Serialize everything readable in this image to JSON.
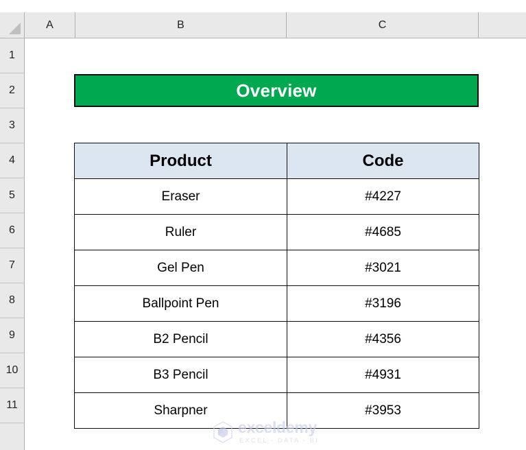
{
  "app": {
    "type": "spreadsheet",
    "select_all_label": "Select All"
  },
  "columns": [
    {
      "label": "A"
    },
    {
      "label": "B"
    },
    {
      "label": "C"
    },
    {
      "label": ""
    }
  ],
  "rows": [
    {
      "label": "1"
    },
    {
      "label": "2"
    },
    {
      "label": "3"
    },
    {
      "label": "4"
    },
    {
      "label": "5"
    },
    {
      "label": "6"
    },
    {
      "label": "7"
    },
    {
      "label": "8"
    },
    {
      "label": "9"
    },
    {
      "label": "10"
    },
    {
      "label": "11"
    },
    {
      "label": ""
    }
  ],
  "title_banner": {
    "text": "Overview",
    "fill_color": "#00A94F",
    "text_color": "#FFFFFF",
    "border_color": "#0D0D0D"
  },
  "table": {
    "header_fill": "#DCE6F1",
    "border_color": "#0D0D0D",
    "headers": [
      "Product",
      "Code"
    ],
    "rows": [
      {
        "product": "Eraser",
        "code": "#4227"
      },
      {
        "product": "Ruler",
        "code": "#4685"
      },
      {
        "product": "Gel Pen",
        "code": "#3021"
      },
      {
        "product": "Ballpoint Pen",
        "code": "#3196"
      },
      {
        "product": "B2 Pencil",
        "code": "#4356"
      },
      {
        "product": "B3 Pencil",
        "code": "#4931"
      },
      {
        "product": "Sharpner",
        "code": "#3953"
      }
    ]
  },
  "watermark": {
    "name": "exceldemy",
    "tagline": "EXCEL - DATA - BI",
    "color": "#C5CBE8"
  }
}
